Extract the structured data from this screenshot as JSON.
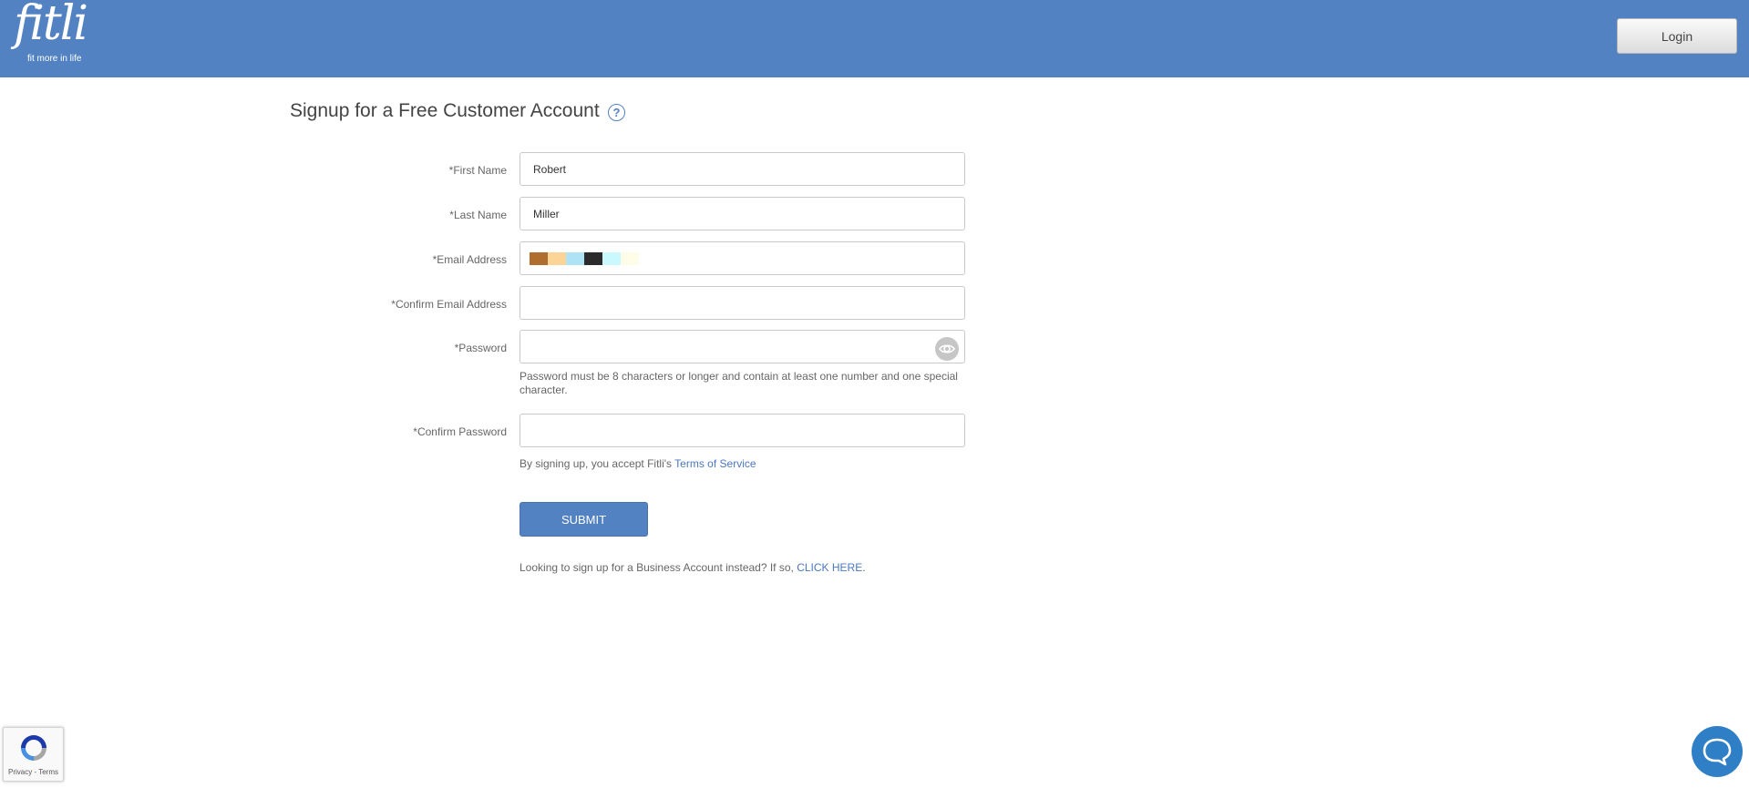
{
  "header": {
    "logo_word": "fitli",
    "logo_tagline": "fit more in life",
    "login_label": "Login"
  },
  "page": {
    "title": "Signup for a Free Customer Account",
    "help_glyph": "?"
  },
  "form": {
    "first_name": {
      "label": "*First Name",
      "value": "Robert"
    },
    "last_name": {
      "label": "*Last Name",
      "value": "Miller"
    },
    "email": {
      "label": "*Email Address",
      "value": "",
      "redacted_colors": [
        "#b06e2e",
        "#fcd596",
        "#aee3f5",
        "#2b2b2b",
        "#c9f9ff",
        "#fffde8"
      ]
    },
    "confirm_email": {
      "label": "*Confirm Email Address",
      "value": ""
    },
    "password": {
      "label": "*Password",
      "value": ""
    },
    "password_hint": "Password must be 8 characters or longer and contain at least one number and one special character.",
    "confirm_password": {
      "label": "*Confirm Password",
      "value": ""
    },
    "tos_prefix": "By signing up, you accept Fitli's",
    "tos_link": "Terms of Service",
    "submit_label": "SUBMIT",
    "business_prefix": "Looking to sign up for a Business Account instead? If so,",
    "business_link": "CLICK HERE",
    "business_suffix": "."
  },
  "recaptcha": {
    "links": "Privacy - Terms"
  },
  "colors": {
    "brand": "#5382c2",
    "link": "#4a78c0",
    "chat": "#2f7fc7"
  }
}
